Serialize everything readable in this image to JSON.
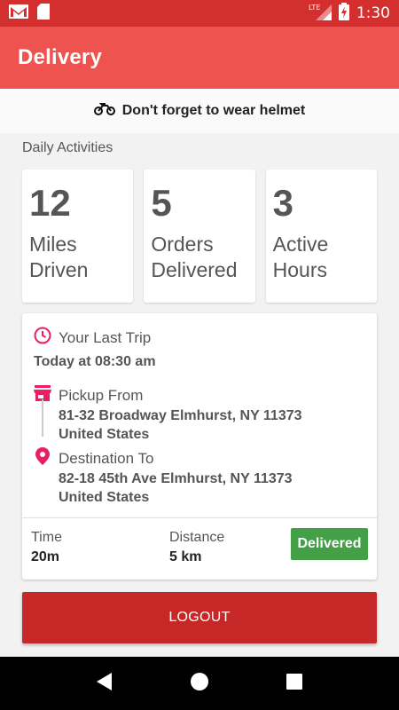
{
  "status_bar": {
    "time": "1:30",
    "network": "LTE",
    "icons": [
      "gmail-icon",
      "sd-card-icon",
      "signal-icon",
      "battery-charging-icon"
    ]
  },
  "app_bar": {
    "title": "Delivery"
  },
  "helmet_notice": {
    "icon": "motorcycle-icon",
    "text": "Don't forget to wear helmet"
  },
  "daily_activities": {
    "label": "Daily Activities",
    "stats": [
      {
        "value": "12",
        "label": "Miles Driven"
      },
      {
        "value": "5",
        "label": "Orders Delivered"
      },
      {
        "value": "3",
        "label": "Active Hours"
      }
    ]
  },
  "last_trip": {
    "heading": "Your Last Trip",
    "datetime": "Today at 08:30 am",
    "pickup": {
      "label": "Pickup From",
      "line1": "81-32 Broadway Elmhurst, NY 11373",
      "line2": "United States"
    },
    "destination": {
      "label": "Destination To",
      "line1": "82-18 45th Ave Elmhurst, NY 11373",
      "line2": "United States"
    },
    "time": {
      "label": "Time",
      "value": "20m"
    },
    "distance": {
      "label": "Distance",
      "value": "5 km"
    },
    "status": "Delivered"
  },
  "logout": {
    "label": "LOGOUT"
  },
  "colors": {
    "status_bar": "#d32f2f",
    "app_bar": "#ef5350",
    "accent_pink": "#e91e63",
    "delivered_green": "#43a047",
    "logout_red": "#c62828"
  }
}
